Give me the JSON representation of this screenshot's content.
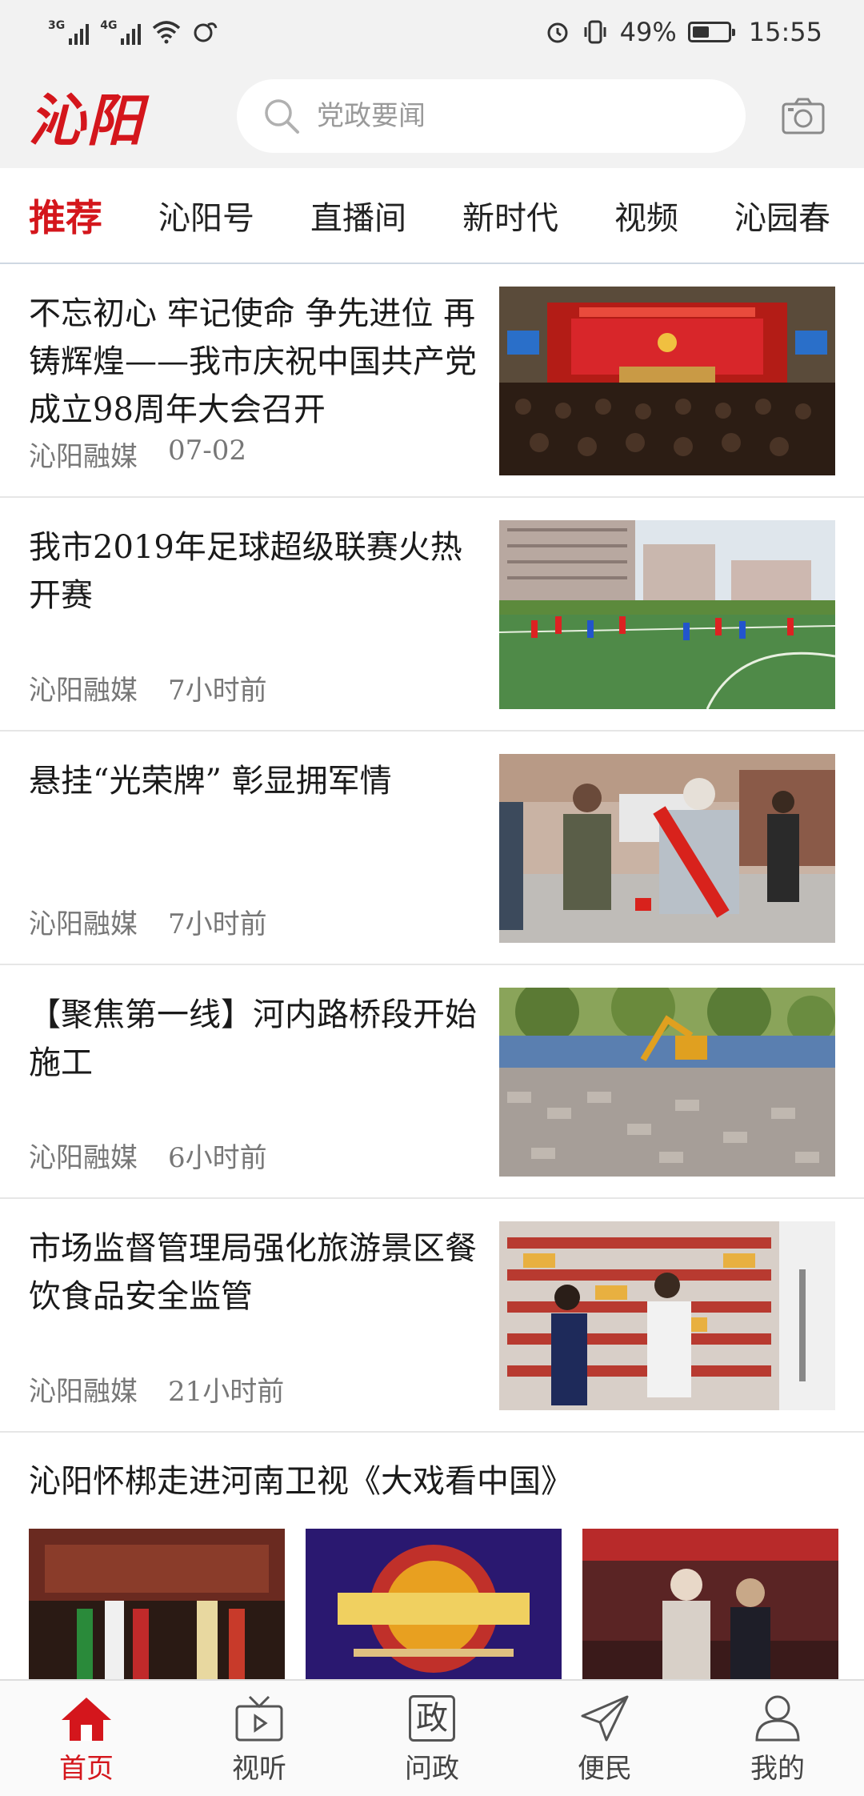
{
  "status_bar": {
    "signal_1": "3G",
    "signal_2": "4G",
    "battery": "49%",
    "time": "15:55"
  },
  "header": {
    "logo": "沁阳",
    "search_placeholder": "党政要闻"
  },
  "tabs": [
    {
      "label": "推荐"
    },
    {
      "label": "沁阳号"
    },
    {
      "label": "直播间"
    },
    {
      "label": "新时代"
    },
    {
      "label": "视频"
    },
    {
      "label": "沁园春"
    }
  ],
  "news": [
    {
      "title": "不忘初心 牢记使命 争先进位 再铸辉煌——我市庆祝中国共产党成立98周年大会召开",
      "source": "沁阳融媒",
      "time": "07-02"
    },
    {
      "title": "我市2019年足球超级联赛火热开赛",
      "source": "沁阳融媒",
      "time": "7小时前"
    },
    {
      "title": "悬挂“光荣牌” 彰显拥军情",
      "source": "沁阳融媒",
      "time": "7小时前"
    },
    {
      "title": "【聚焦第一线】河内路桥段开始施工",
      "source": "沁阳融媒",
      "time": "6小时前"
    },
    {
      "title": "市场监督管理局强化旅游景区餐饮食品安全监管",
      "source": "沁阳融媒",
      "time": "21小时前"
    }
  ],
  "gallery": {
    "title": "沁阳怀梆走进河南卫视《大戏看中国》"
  },
  "bottom_nav": [
    {
      "label": "首页",
      "icon": "home-icon"
    },
    {
      "label": "视听",
      "icon": "tv-icon"
    },
    {
      "label": "问政",
      "icon": "zheng-icon",
      "glyph": "政"
    },
    {
      "label": "便民",
      "icon": "send-icon"
    },
    {
      "label": "我的",
      "icon": "user-icon"
    }
  ],
  "colors": {
    "accent": "#d4161c",
    "header_bg": "#f2f2f2"
  }
}
